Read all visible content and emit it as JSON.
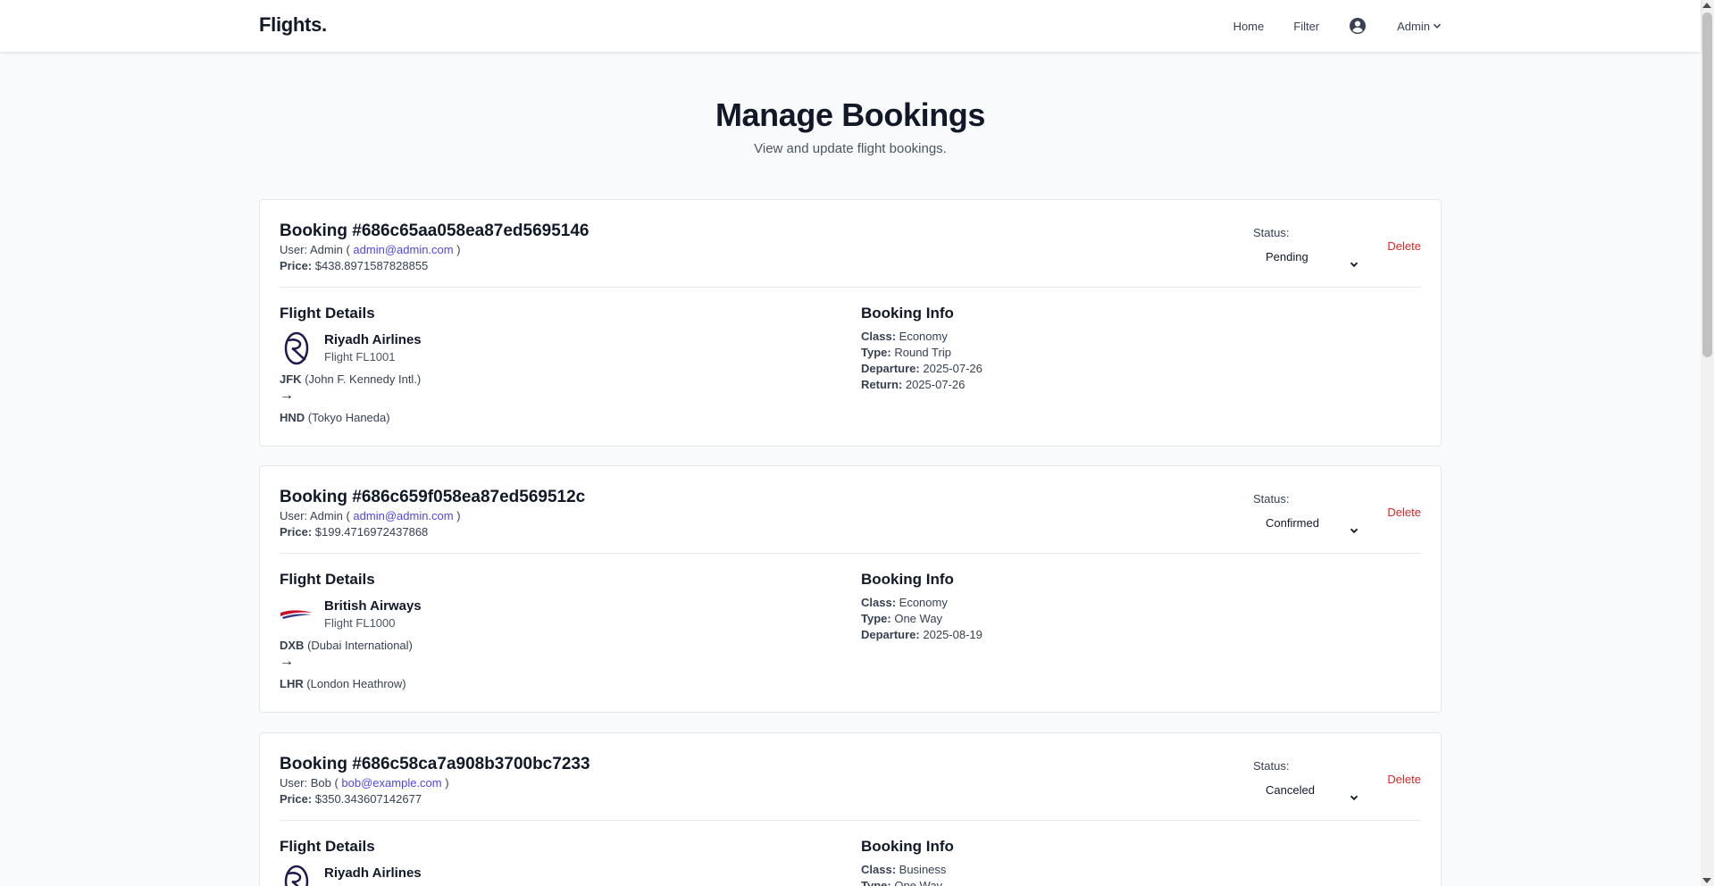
{
  "nav": {
    "brand": "Flights.",
    "home": "Home",
    "filter": "Filter",
    "user": "Admin",
    "icons": {
      "user": "user-circle-icon",
      "chevron": "chevron-down-icon"
    }
  },
  "header": {
    "title": "Manage Bookings",
    "subtitle": "View and update flight bookings."
  },
  "labels": {
    "user_prefix": "User:",
    "open_paren": "(",
    "close_paren": ")",
    "price": "Price:",
    "status": "Status:",
    "delete": "Delete",
    "flight_details": "Flight Details",
    "booking_info": "Booking Info",
    "class": "Class:",
    "type": "Type:",
    "departure": "Departure:",
    "return": "Return:",
    "arrow": "→"
  },
  "colors": {
    "accent": "#4f46e5",
    "danger": "#dc2626",
    "text": "#111827"
  },
  "bookings": [
    {
      "title": "Booking #686c65aa058ea87ed5695146",
      "user_name": "Admin",
      "user_email": "admin@admin.com",
      "price": "$438.8971587828855",
      "status": "Pending",
      "airline": "Riyadh Airlines",
      "airline_icon": "riyadh-airlines-logo-icon",
      "flight": "Flight FL1001",
      "from_code": "JFK",
      "from_name": "(John F. Kennedy Intl.)",
      "to_code": "HND",
      "to_name": "(Tokyo Haneda)",
      "class": "Economy",
      "type": "Round Trip",
      "departure": "2025-07-26",
      "return": "2025-07-26"
    },
    {
      "title": "Booking #686c659f058ea87ed569512c",
      "user_name": "Admin",
      "user_email": "admin@admin.com",
      "price": "$199.4716972437868",
      "status": "Confirmed",
      "airline": "British Airways",
      "airline_icon": "british-airways-logo-icon",
      "flight": "Flight FL1000",
      "from_code": "DXB",
      "from_name": "(Dubai International)",
      "to_code": "LHR",
      "to_name": "(London Heathrow)",
      "class": "Economy",
      "type": "One Way",
      "departure": "2025-08-19"
    },
    {
      "title": "Booking #686c58ca7a908b3700bc7233",
      "user_name": "Bob",
      "user_email": "bob@example.com",
      "price": "$350.343607142677",
      "status": "Canceled",
      "airline": "Riyadh Airlines",
      "airline_icon": "riyadh-airlines-logo-icon",
      "class": "Business",
      "type": "One Way"
    }
  ]
}
